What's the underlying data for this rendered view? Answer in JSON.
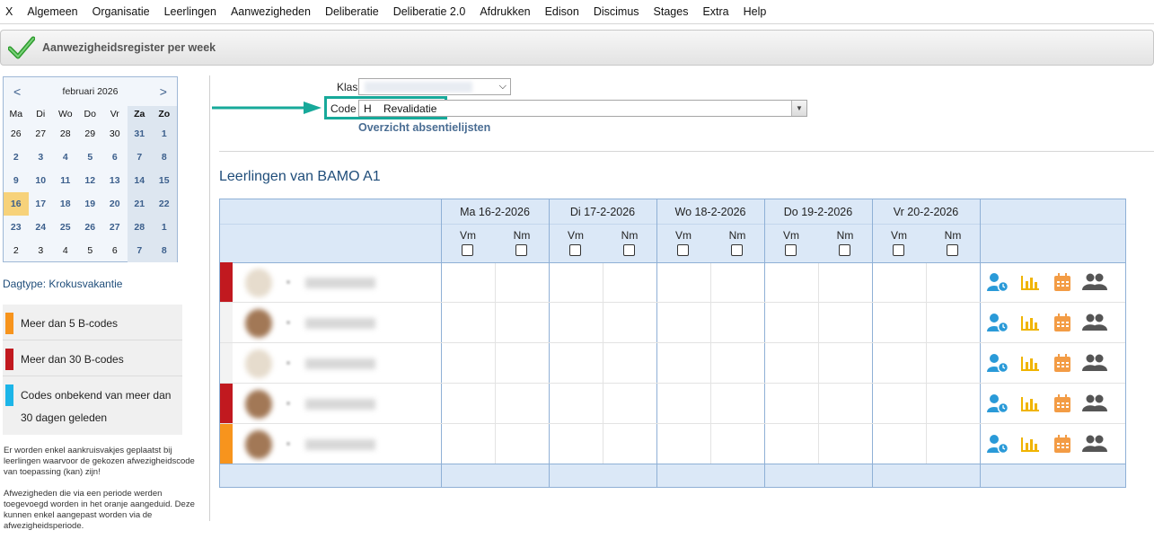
{
  "menu": [
    "X",
    "Algemeen",
    "Organisatie",
    "Leerlingen",
    "Aanwezigheden",
    "Deliberatie",
    "Deliberatie 2.0",
    "Afdrukken",
    "Edison",
    "Discimus",
    "Stages",
    "Extra",
    "Help"
  ],
  "page_title": "Aanwezigheidsregister per week",
  "calendar": {
    "prev": "<",
    "next": ">",
    "month_label": "februari 2026",
    "weekdays": [
      "Ma",
      "Di",
      "Wo",
      "Do",
      "Vr",
      "Za",
      "Zo"
    ],
    "weeks": [
      [
        "26",
        "27",
        "28",
        "29",
        "30",
        "31",
        "1"
      ],
      [
        "2",
        "3",
        "4",
        "5",
        "6",
        "7",
        "8"
      ],
      [
        "9",
        "10",
        "11",
        "12",
        "13",
        "14",
        "15"
      ],
      [
        "16",
        "17",
        "18",
        "19",
        "20",
        "21",
        "22"
      ],
      [
        "23",
        "24",
        "25",
        "26",
        "27",
        "28",
        "1"
      ],
      [
        "2",
        "3",
        "4",
        "5",
        "6",
        "7",
        "8"
      ]
    ],
    "selected_day": "16"
  },
  "daytype": "Dagtype: Krokusvakantie",
  "legend": [
    {
      "color": "#f7941d",
      "text": "Meer dan 5 B-codes"
    },
    {
      "color": "#c1191f",
      "text": "Meer dan 30 B-codes"
    },
    {
      "color": "#1cb5e8",
      "text": "Codes onbekend van meer dan 30 dagen geleden"
    }
  ],
  "note1": "Er worden enkel aankruisvakjes geplaatst bij leerlingen waarvoor de gekozen afwezigheidscode van toepassing (kan) zijn!",
  "note2": "Afwezigheden die via een periode werden toegevoegd worden in het oranje aangeduid. Deze kunnen enkel aangepast worden via de afwezigheidsperiode.",
  "form": {
    "klas_label": "Klas",
    "code_label": "Code",
    "code_value": "H    Revalidatie",
    "overview_link": "Overzicht absentielijsten"
  },
  "section_title": "Leerlingen van BAMO A1",
  "days": [
    "Ma 16-2-2026",
    "Di 17-2-2026",
    "Wo 18-2-2026",
    "Do 19-2-2026",
    "Vr 20-2-2026"
  ],
  "slots": [
    "Vm",
    "Nm"
  ],
  "students": [
    {
      "status_color": "#c1191f",
      "avatar": "light"
    },
    {
      "status_color": "",
      "avatar": "dark"
    },
    {
      "status_color": "",
      "avatar": "light"
    },
    {
      "status_color": "#c1191f",
      "avatar": "dark"
    },
    {
      "status_color": "#f7941d",
      "avatar": "dark"
    }
  ],
  "row_icons": [
    "user-clock-icon",
    "bar-chart-icon",
    "calendar-icon",
    "users-icon"
  ],
  "colors": {
    "accent": "#17a99a",
    "header_band": "#dbe8f7",
    "grid_border": "#8fb0d6",
    "link": "#4a6d93"
  }
}
